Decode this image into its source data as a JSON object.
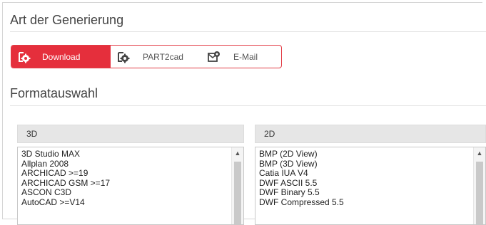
{
  "generation": {
    "title": "Art der Generierung",
    "options": [
      {
        "label": "Download",
        "icon": "download-gear-icon",
        "active": true
      },
      {
        "label": "PART2cad",
        "icon": "part2cad-gear-icon",
        "active": false
      },
      {
        "label": "E-Mail",
        "icon": "email-gear-icon",
        "active": false
      }
    ]
  },
  "format": {
    "title": "Formatauswahl",
    "list3d": {
      "header": "3D",
      "items": [
        "3D Studio MAX",
        "Allplan 2008",
        "ARCHICAD >=19",
        "ARCHICAD GSM >=17",
        "ASCON C3D",
        "AutoCAD >=V14"
      ]
    },
    "list2d": {
      "header": "2D",
      "items": [
        "BMP (2D View)",
        "BMP (3D View)",
        "Catia IUA V4",
        "DWF ASCII 5.5",
        "DWF Binary 5.5",
        "DWF Compressed 5.5"
      ]
    }
  },
  "colors": {
    "accent": "#e52f3c",
    "header_bg": "#e6e6e6"
  }
}
